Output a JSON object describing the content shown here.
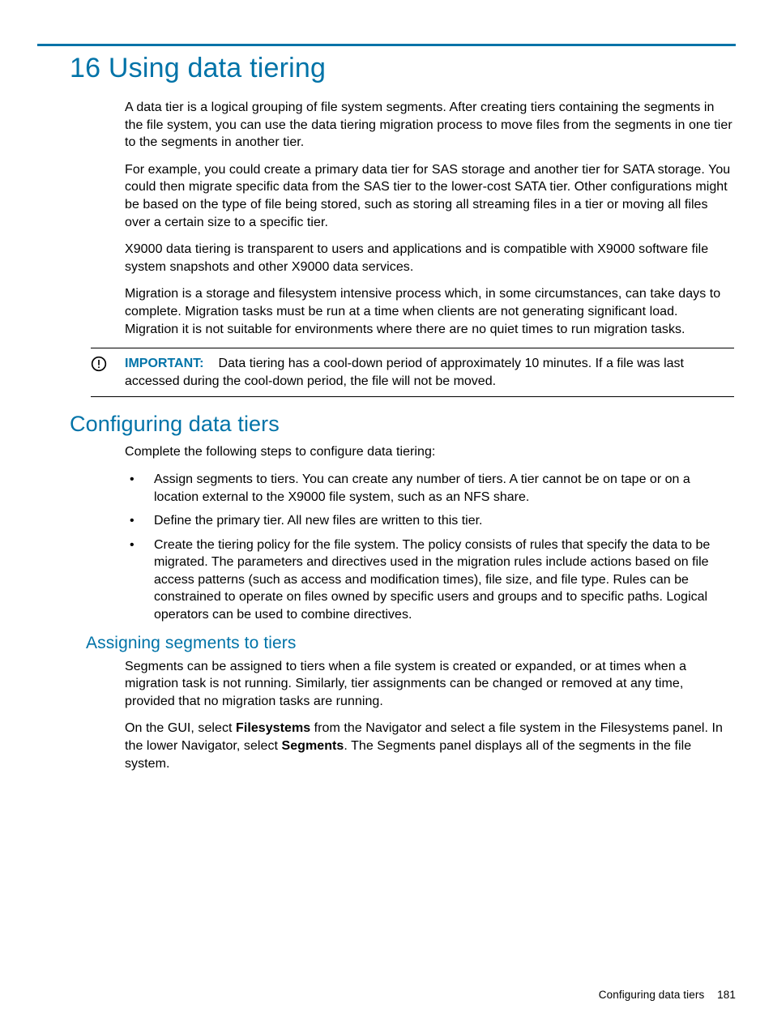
{
  "chapter": {
    "number": "16",
    "title": "Using data tiering"
  },
  "intro": {
    "p1": "A data tier is a logical grouping of file system segments. After creating tiers containing the segments in the file system, you can use the data tiering migration process to move files from the segments in one tier to the segments in another tier.",
    "p2": "For example, you could create a primary data tier for SAS storage and another tier for SATA storage. You could then migrate specific data from the SAS tier to the lower-cost SATA tier. Other configurations might be based on the type of file being stored, such as storing all streaming files in a tier or moving all files over a certain size to a specific tier.",
    "p3": "X9000 data tiering is transparent to users and applications and is compatible with X9000 software file system snapshots and other X9000 data services.",
    "p4": "Migration is a storage and filesystem intensive process which, in some circumstances, can take days to complete. Migration tasks must be run at a time when clients are not generating significant load. Migration it is not suitable for environments where there are no quiet times to run migration tasks."
  },
  "important": {
    "label": "IMPORTANT:",
    "text": "Data tiering has a cool-down period of approximately 10 minutes. If a file was last accessed during the cool-down period, the file will not be moved."
  },
  "sect1": {
    "title": "Configuring data tiers",
    "lead": "Complete the following steps to configure data tiering:",
    "bullets": [
      "Assign segments to tiers. You can create any number of tiers. A tier cannot be on tape or on a location external to the X9000 file system, such as an NFS share.",
      "Define the primary tier. All new files are written to this tier.",
      "Create the tiering policy for the file system. The policy consists of rules that specify the data to be migrated. The parameters and directives used in the migration rules include actions based on file access patterns (such as access and modification times), file size, and file type. Rules can be constrained to operate on files owned by specific users and groups and to specific paths. Logical operators can be used to combine directives."
    ]
  },
  "sect2": {
    "title": "Assigning segments to tiers",
    "p1": "Segments can be assigned to tiers when a file system is created or expanded, or at times when a migration task is not running. Similarly, tier assignments can be changed or removed at any time, provided that no migration tasks are running.",
    "p2_pre": "On the GUI, select ",
    "p2_b1": "Filesystems",
    "p2_mid": " from the Navigator and select a file system in the Filesystems panel. In the lower Navigator, select ",
    "p2_b2": "Segments",
    "p2_post": ". The Segments panel displays all of the segments in the file system."
  },
  "footer": {
    "text": "Configuring data tiers",
    "page": "181"
  }
}
